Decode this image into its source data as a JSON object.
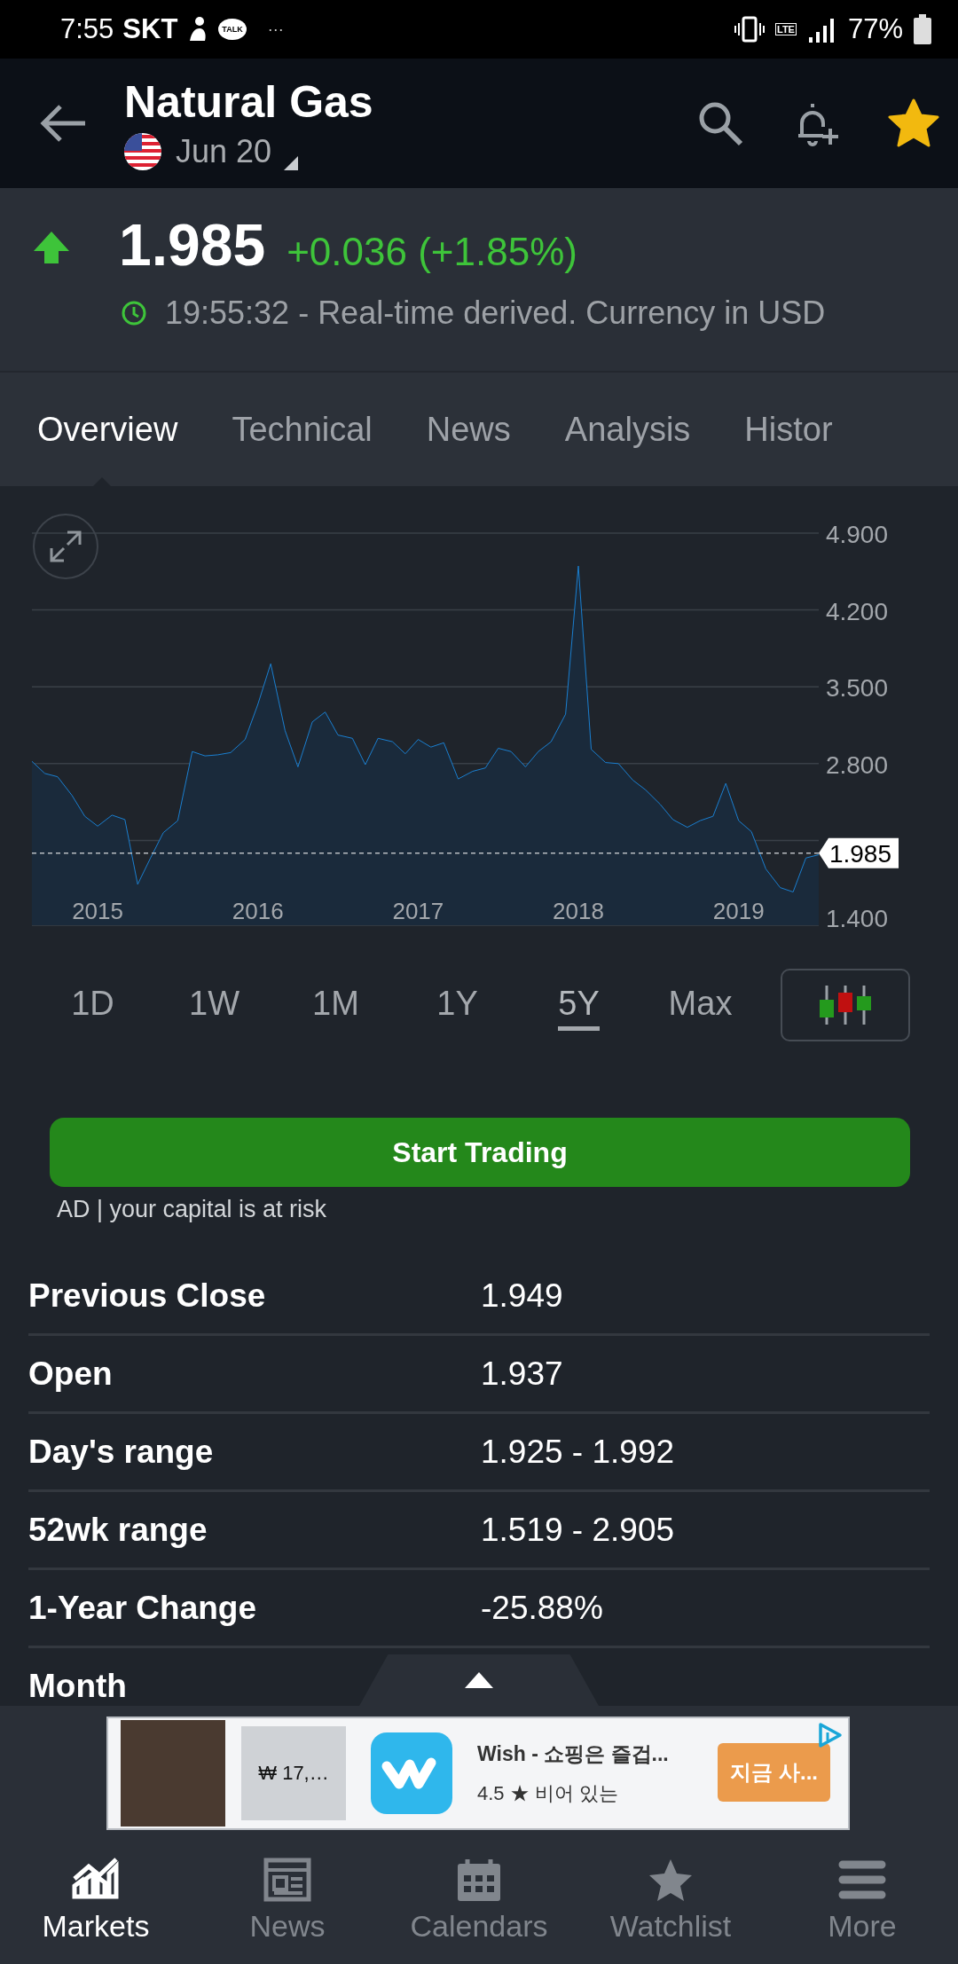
{
  "status_bar": {
    "time": "7:55",
    "carrier": "SKT",
    "talk_badge": "TALK",
    "more": "···",
    "network": "LTE",
    "battery": "77%"
  },
  "header": {
    "title": "Natural Gas",
    "contract": "Jun 20",
    "favorite": true
  },
  "quote": {
    "rising": true,
    "price": "1.985",
    "change": "+0.036 (+1.85%)",
    "timestamp": "19:55:32 - Real-time derived. Currency in USD"
  },
  "tabs": [
    {
      "label": "Overview",
      "selected": true
    },
    {
      "label": "Technical",
      "selected": false
    },
    {
      "label": "News",
      "selected": false
    },
    {
      "label": "Analysis",
      "selected": false
    },
    {
      "label": "Histor",
      "selected": false
    }
  ],
  "chart": {
    "chart_data": {
      "type": "area",
      "grid": true,
      "x": [
        2014.59,
        2014.67,
        2014.75,
        2014.84,
        2014.92,
        2015.0,
        2015.09,
        2015.17,
        2015.25,
        2015.33,
        2015.41,
        2015.5,
        2015.59,
        2015.67,
        2015.75,
        2015.83,
        2015.92,
        2016.0,
        2016.08,
        2016.17,
        2016.25,
        2016.34,
        2016.42,
        2016.5,
        2016.59,
        2016.67,
        2016.75,
        2016.84,
        2016.92,
        2017.0,
        2017.08,
        2017.16,
        2017.25,
        2017.34,
        2017.42,
        2017.5,
        2017.58,
        2017.67,
        2017.75,
        2017.83,
        2017.92,
        2018.0,
        2018.08,
        2018.17,
        2018.25,
        2018.34,
        2018.42,
        2018.51,
        2018.59,
        2018.68,
        2018.76,
        2018.84,
        2018.92,
        2019.0,
        2019.08,
        2019.17,
        2019.26,
        2019.34,
        2019.42,
        2019.5
      ],
      "series": [
        {
          "color": "#1a7fd0",
          "values": [
            2.82,
            2.71,
            2.68,
            2.51,
            2.32,
            2.23,
            2.33,
            2.29,
            1.7,
            1.94,
            2.17,
            2.28,
            2.91,
            2.87,
            2.88,
            2.9,
            3.02,
            3.34,
            3.71,
            3.1,
            2.77,
            3.18,
            3.27,
            3.06,
            3.03,
            2.79,
            3.03,
            3.0,
            2.89,
            3.02,
            2.95,
            2.99,
            2.66,
            2.73,
            2.76,
            2.94,
            2.91,
            2.77,
            2.91,
            3.0,
            3.25,
            4.6,
            2.93,
            2.81,
            2.8,
            2.65,
            2.56,
            2.43,
            2.29,
            2.22,
            2.28,
            2.32,
            2.62,
            2.28,
            2.18,
            1.84,
            1.67,
            1.63,
            1.94,
            1.97
          ]
        }
      ],
      "xlim": [
        2014.59,
        2019.5
      ],
      "ylim": [
        1.4,
        4.9
      ],
      "xticks": [
        {
          "value": 2015,
          "label": "2015"
        },
        {
          "value": 2016,
          "label": "2016"
        },
        {
          "value": 2017,
          "label": "2017"
        },
        {
          "value": 2018,
          "label": "2018"
        },
        {
          "value": 2019,
          "label": "2019"
        }
      ],
      "yticks": [
        {
          "value": 1.4,
          "label": "1.400"
        },
        {
          "value": 2.8,
          "label": "2.800"
        },
        {
          "value": 3.5,
          "label": "3.500"
        },
        {
          "value": 4.2,
          "label": "4.200"
        },
        {
          "value": 4.9,
          "label": "4.900"
        }
      ],
      "ref_lines": [
        {
          "axis": "y",
          "value": 1.985,
          "label": "1.985"
        }
      ]
    }
  },
  "ranges": [
    {
      "label": "1D",
      "selected": false
    },
    {
      "label": "1W",
      "selected": false
    },
    {
      "label": "1M",
      "selected": false
    },
    {
      "label": "1Y",
      "selected": false
    },
    {
      "label": "5Y",
      "selected": true
    },
    {
      "label": "Max",
      "selected": false
    }
  ],
  "trade": {
    "button": "Start Trading",
    "disclaimer": "AD | your capital is at risk"
  },
  "stats": [
    {
      "label": "Previous Close",
      "value": "1.949"
    },
    {
      "label": "Open",
      "value": "1.937"
    },
    {
      "label": "Day's range",
      "value": "1.925 - 1.992"
    },
    {
      "label": "52wk range",
      "value": "1.519 - 2.905"
    },
    {
      "label": "1-Year Change",
      "value": "-25.88%"
    },
    {
      "label": "Month"
    }
  ],
  "ad": {
    "price": "₩ 17,…",
    "title": "Wish - 쇼핑은 즐겁...",
    "rating": "4.5 ★ 비어 있는",
    "cta": "지금 사..."
  },
  "nav": [
    {
      "label": "Markets",
      "kind": "markets",
      "selected": true
    },
    {
      "label": "News",
      "kind": "news",
      "selected": false
    },
    {
      "label": "Calendars",
      "kind": "calendars",
      "selected": false
    },
    {
      "label": "Watchlist",
      "kind": "watchlist",
      "selected": false
    },
    {
      "label": "More",
      "kind": "more",
      "selected": false
    }
  ]
}
